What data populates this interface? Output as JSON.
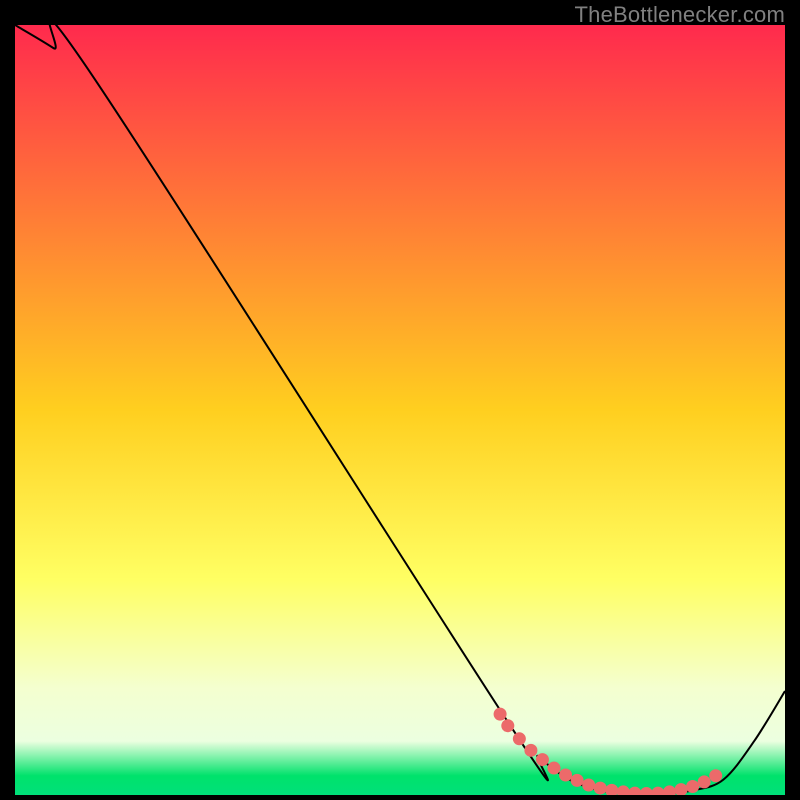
{
  "watermark": "TheBottlenecker.com",
  "chart_data": {
    "type": "line",
    "title": "",
    "xlabel": "",
    "ylabel": "",
    "xlim": [
      0,
      100
    ],
    "ylim": [
      0,
      100
    ],
    "background_gradient": {
      "stops": [
        {
          "pos": 0.0,
          "color": "#ff2a4d"
        },
        {
          "pos": 0.5,
          "color": "#ffcf1f"
        },
        {
          "pos": 0.72,
          "color": "#ffff63"
        },
        {
          "pos": 0.86,
          "color": "#f4ffcf"
        },
        {
          "pos": 0.93,
          "color": "#ecffe0"
        },
        {
          "pos": 0.975,
          "color": "#00e26b"
        },
        {
          "pos": 1.0,
          "color": "#00e07a"
        }
      ]
    },
    "series": [
      {
        "name": "bottleneck-curve",
        "x": [
          0,
          5,
          10,
          64,
          68,
          72,
          76,
          80,
          84,
          88,
          92,
          96,
          100
        ],
        "y": [
          100,
          97,
          93.5,
          9.5,
          5.0,
          2.0,
          0.6,
          0.2,
          0.2,
          0.6,
          2.0,
          7.0,
          13.5
        ]
      }
    ],
    "highlight_points": {
      "name": "optimal-range",
      "x": [
        63,
        64,
        65.5,
        67,
        68.5,
        70,
        71.5,
        73,
        74.5,
        76,
        77.5,
        79,
        80.5,
        82,
        83.5,
        85,
        86.5,
        88,
        89.5,
        91
      ],
      "y": [
        10.5,
        9.0,
        7.3,
        5.8,
        4.6,
        3.5,
        2.6,
        1.9,
        1.3,
        0.9,
        0.6,
        0.4,
        0.25,
        0.2,
        0.25,
        0.4,
        0.7,
        1.1,
        1.7,
        2.5
      ]
    },
    "colors": {
      "curve": "#000000",
      "points": "#ec6a6a"
    }
  }
}
